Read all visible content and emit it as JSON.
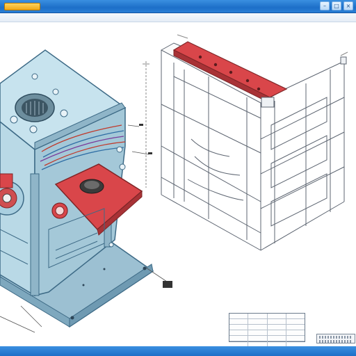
{
  "window": {
    "title": "",
    "buttons": {
      "minimize": "–",
      "maximize": "□",
      "close": "×"
    }
  },
  "colors": {
    "titlebar": "#1d6fc8",
    "housing_fill": "#a9cfe0",
    "housing_stroke": "#3d6a86",
    "highlight_red": "#d9464a",
    "base_plate": "#8fb7cc",
    "wireframe": "#5c6470"
  },
  "drawing": {
    "title_block_rows": 6,
    "title_block_cols": 4
  }
}
